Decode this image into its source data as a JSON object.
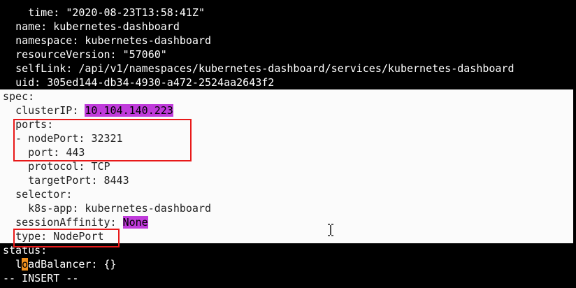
{
  "editor": {
    "mode_line": "-- INSERT --",
    "lines": [
      {
        "indent": "    ",
        "key": "time",
        "value": "\"2020-08-23T13:58:41Z\""
      },
      {
        "indent": "  ",
        "key": "name",
        "value": "kubernetes-dashboard"
      },
      {
        "indent": "  ",
        "key": "namespace",
        "value": "kubernetes-dashboard"
      },
      {
        "indent": "  ",
        "key": "resourceVersion",
        "value": "\"57060\""
      },
      {
        "indent": "  ",
        "key": "selfLink",
        "value": "/api/v1/namespaces/kubernetes-dashboard/services/kubernetes-dashboard"
      },
      {
        "indent": "  ",
        "key": "uid",
        "value": "305ed144-db34-4930-a472-2524aa2643f2"
      },
      {
        "indent": "",
        "key": "spec",
        "value": ""
      },
      {
        "indent": "  ",
        "key": "clusterIP",
        "value": "10.104.140.223"
      },
      {
        "indent": "  ",
        "key": "ports",
        "value": ""
      },
      {
        "indent": "  - ",
        "key": "nodePort",
        "value": "32321"
      },
      {
        "indent": "    ",
        "key": "port",
        "value": "443"
      },
      {
        "indent": "    ",
        "key": "protocol",
        "value": "TCP"
      },
      {
        "indent": "    ",
        "key": "targetPort",
        "value": "8443"
      },
      {
        "indent": "  ",
        "key": "selector",
        "value": ""
      },
      {
        "indent": "    ",
        "key": "k8s-app",
        "value": "kubernetes-dashboard"
      },
      {
        "indent": "  ",
        "key": "sessionAffinity",
        "value": "None"
      },
      {
        "indent": "  ",
        "key": "type",
        "value": "NodePort"
      },
      {
        "indent": "",
        "key": "status",
        "value": ""
      },
      {
        "indent": "  ",
        "key": "loadBalancer",
        "value": "{}"
      }
    ]
  },
  "colors": {
    "terminal_bg": "#000000",
    "selection_band": "#fbfbfb",
    "highlight": "#c03bdb",
    "cursor": "#f0901e",
    "annotation_box": "#e81919"
  }
}
